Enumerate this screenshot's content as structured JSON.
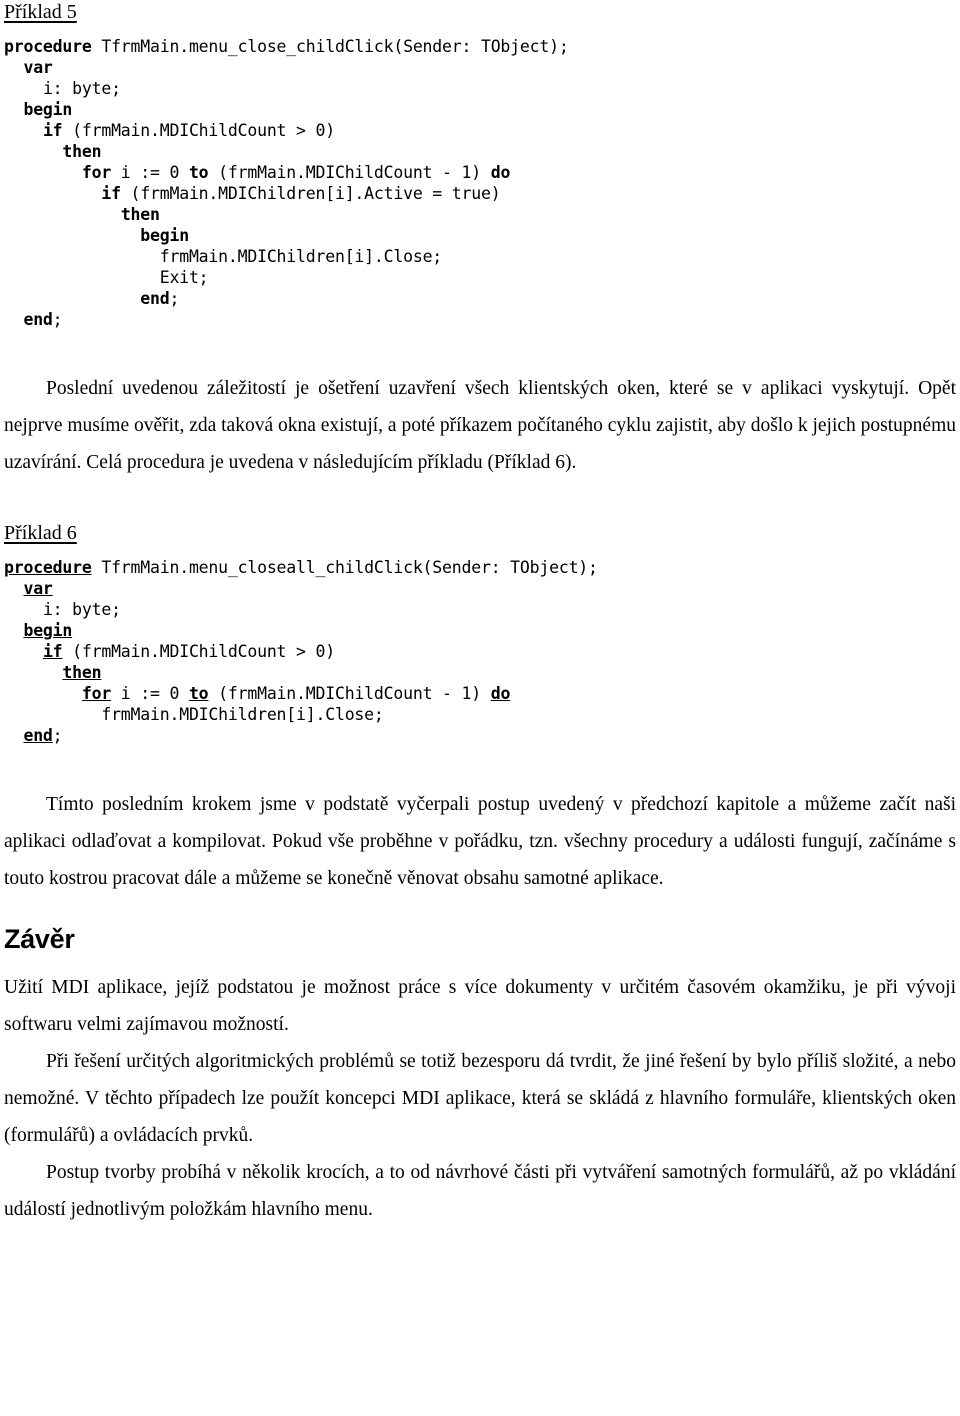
{
  "document": {
    "language": "cs",
    "example5": {
      "caption": "Příklad 5",
      "code_lines": [
        {
          "indent": 0,
          "keyword": "procedure",
          "rest": " TfrmMain.menu_close_childClick(Sender: TObject);"
        },
        {
          "indent": 2,
          "keyword": "var",
          "rest": ""
        },
        {
          "indent": 4,
          "keyword": "",
          "rest": "i: byte;"
        },
        {
          "indent": 2,
          "keyword": "begin",
          "rest": ""
        },
        {
          "indent": 4,
          "keyword": "if",
          "rest": " (frmMain.MDIChildCount > 0)"
        },
        {
          "indent": 6,
          "keyword": "then",
          "rest": ""
        },
        {
          "indent": 8,
          "keyword": "for",
          "rest": " i := 0 ",
          "keyword2": "to",
          "rest2": " (frmMain.MDIChildCount - 1) ",
          "keyword3": "do",
          "rest3": ""
        },
        {
          "indent": 10,
          "keyword": "if",
          "rest": " (frmMain.MDIChildren[i].Active = true)"
        },
        {
          "indent": 12,
          "keyword": "then",
          "rest": ""
        },
        {
          "indent": 14,
          "keyword": "begin",
          "rest": ""
        },
        {
          "indent": 16,
          "keyword": "",
          "rest": "frmMain.MDIChildren[i].Close;"
        },
        {
          "indent": 16,
          "keyword": "",
          "rest": "Exit;"
        },
        {
          "indent": 14,
          "keyword": "end",
          "rest": ";"
        },
        {
          "indent": 2,
          "keyword": "end",
          "rest": ";"
        }
      ]
    },
    "paragraph1": "Poslední uvedenou záležitostí je ošetření uzavření všech klientských oken, které se v aplikaci vyskytují. Opět nejprve musíme ověřit, zda taková okna existují, a poté příkazem počítaného cyklu zajistit, aby došlo k jejich postupnému uzavírání. Celá procedura je uvedena v následujícím příkladu (Příklad 6).",
    "example6": {
      "caption": "Příklad 6",
      "code_lines": [
        {
          "indent": 0,
          "keyword": "procedure",
          "rest": " TfrmMain.menu_closeall_childClick(Sender: TObject);"
        },
        {
          "indent": 2,
          "keyword": "var",
          "rest": ""
        },
        {
          "indent": 4,
          "keyword": "",
          "rest": "i: byte;"
        },
        {
          "indent": 2,
          "keyword": "begin",
          "rest": ""
        },
        {
          "indent": 4,
          "keyword": "if",
          "rest": " (frmMain.MDIChildCount > 0)"
        },
        {
          "indent": 6,
          "keyword": "then",
          "rest": ""
        },
        {
          "indent": 8,
          "keyword": "for",
          "rest": " i := 0 ",
          "keyword2": "to",
          "rest2": " (frmMain.MDIChildCount - 1) ",
          "keyword3": "do",
          "rest3": ""
        },
        {
          "indent": 10,
          "keyword": "",
          "rest": "frmMain.MDIChildren[i].Close;"
        },
        {
          "indent": 2,
          "keyword": "end",
          "rest": ";"
        }
      ]
    },
    "paragraph2": "Tímto posledním krokem jsme v podstatě vyčerpali postup uvedený v předchozí kapitole a můžeme začít naši aplikaci odlaďovat a kompilovat. Pokud vše proběhne v pořádku, tzn. všechny procedury a události fungují, začínáme s touto kostrou pracovat dále a můžeme se konečně věnovat obsahu samotné aplikace.",
    "conclusion_heading": "Závěr",
    "paragraph3": "Užití MDI aplikace, jejíž podstatou je možnost práce s více dokumenty v určitém časovém okamžiku, je při vývoji softwaru velmi zajímavou možností.",
    "paragraph4": "Při řešení určitých algoritmických problémů se totiž bezesporu dá tvrdit, že jiné řešení by bylo příliš složité, a nebo nemožné. V těchto případech lze použít koncepci MDI aplikace, která se skládá z hlavního formuláře, klientských oken (formulářů) a ovládacích prvků.",
    "paragraph5": "Postup tvorby probíhá v několik krocích, a to od návrhové části při vytváření samotných formulářů, až po vkládání událostí jednotlivým položkám hlavního menu."
  }
}
